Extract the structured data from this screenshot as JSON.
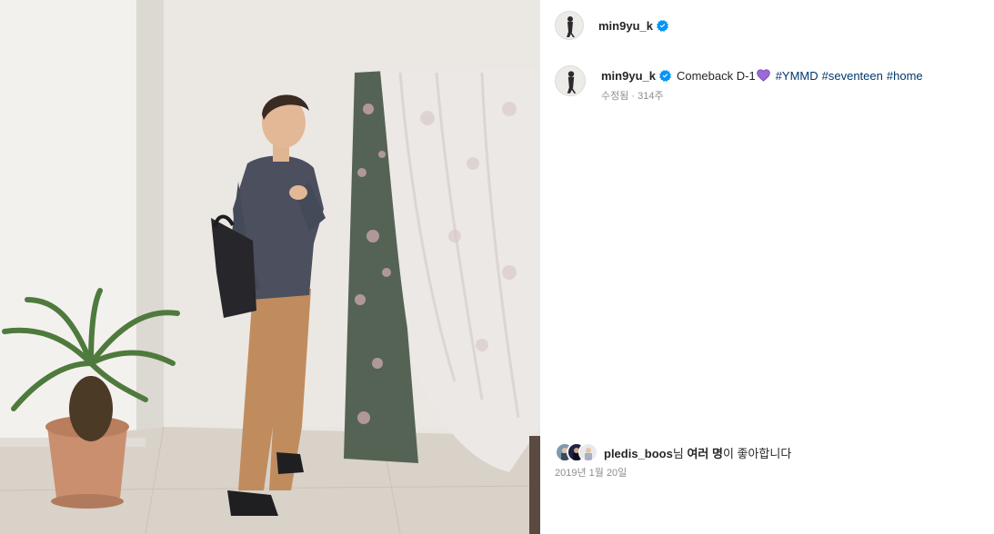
{
  "post": {
    "username": "min9yu_k",
    "caption": {
      "text": "Comeback D-1",
      "emoji": "purple-heart",
      "hashtags": [
        "#YMMD",
        "#seventeen",
        "#home"
      ]
    },
    "edited_label": "수정됨",
    "separator": " · ",
    "age": "314주"
  },
  "likes": {
    "liker": "pledis_boos",
    "suffix_1": "님 ",
    "others": "여러 명",
    "suffix_2": "이 좋아합니다"
  },
  "date": "2019년 1월 20일",
  "colors": {
    "verified_blue": "#0095f6",
    "hashtag_blue": "#00376b",
    "heart_purple": "#9b6ad6",
    "muted_gray": "#8e8e8e"
  },
  "icons": [
    "verified-badge-icon",
    "purple-heart-icon"
  ]
}
